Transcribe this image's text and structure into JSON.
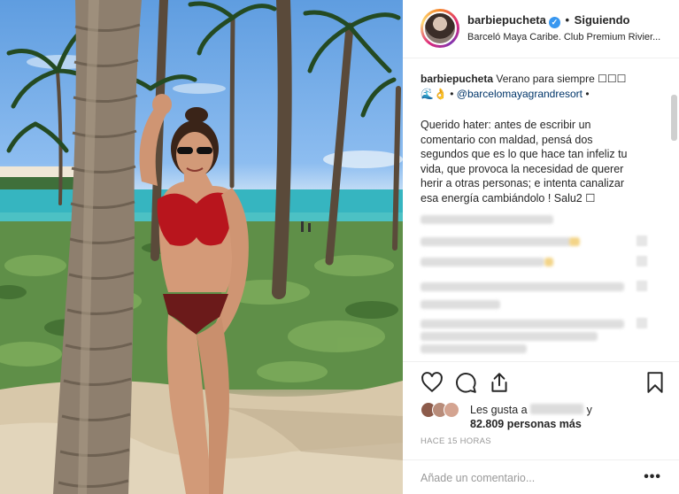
{
  "post": {
    "image_alt": "Woman in red bikini leaning against palm tree on a beach",
    "header": {
      "username": "barbiepucheta",
      "separator": "•",
      "follow_status": "Siguiendo",
      "location": "Barceló Maya Caribe. Club Premium Rivier..."
    },
    "caption": {
      "username": "barbiepucheta",
      "text": "Verano para siempre ☐☐☐",
      "line2_prefix": "🌊👌 •",
      "mention": "@barcelomayagrandresort",
      "line2_suffix": "•"
    },
    "message": "Querido hater: antes de escribir un comentario con maldad, pensá dos segundos que es lo que hace tan infeliz tu vida, que provoca la necesidad de querer herir a otras personas; e intenta canalizar esa energía cambiándolo ! Salu2 ☐",
    "likes": {
      "prefix": "Les gusta a",
      "suffix": "y",
      "count_text": "82.809 personas más"
    },
    "time_ago": "HACE 15 HORAS",
    "comment_placeholder": "Añade un comentario...",
    "more_options": "•••"
  },
  "icons": {
    "verified": "verified-badge-icon",
    "like": "heart-icon",
    "comment": "comment-bubble-icon",
    "share": "share-icon",
    "save": "bookmark-icon"
  },
  "colors": {
    "verified": "#3897f0",
    "mention": "#003569",
    "muted": "#999999"
  }
}
